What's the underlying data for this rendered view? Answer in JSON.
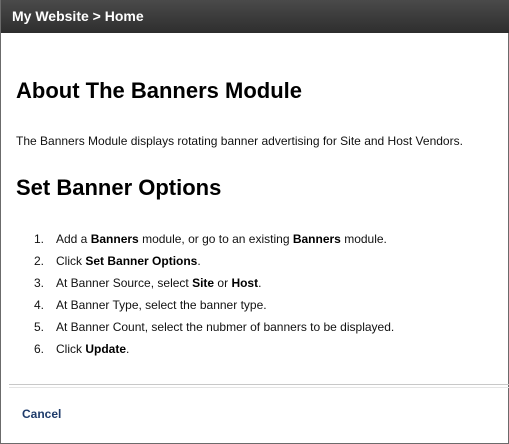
{
  "titlebar": {
    "breadcrumb": "My Website > Home"
  },
  "main": {
    "heading_about": "About The Banners Module",
    "description": "The Banners Module displays rotating banner advertising for Site and Host Vendors.",
    "heading_options": "Set Banner Options",
    "steps": [
      {
        "number": "1.",
        "parts": [
          {
            "t": "Add a ",
            "b": false
          },
          {
            "t": "Banners",
            "b": true
          },
          {
            "t": " module, or go to an existing ",
            "b": false
          },
          {
            "t": "Banners",
            "b": true
          },
          {
            "t": " module.",
            "b": false
          }
        ]
      },
      {
        "number": "2.",
        "parts": [
          {
            "t": "Click ",
            "b": false
          },
          {
            "t": "Set Banner Options",
            "b": true
          },
          {
            "t": ".",
            "b": false
          }
        ]
      },
      {
        "number": "3.",
        "parts": [
          {
            "t": "At Banner Source, select ",
            "b": false
          },
          {
            "t": "Site",
            "b": true
          },
          {
            "t": " or ",
            "b": false
          },
          {
            "t": "Host",
            "b": true
          },
          {
            "t": ".",
            "b": false
          }
        ]
      },
      {
        "number": "4.",
        "parts": [
          {
            "t": "At Banner Type, select the banner type.",
            "b": false
          }
        ]
      },
      {
        "number": "5.",
        "parts": [
          {
            "t": "At Banner Count, select the nubmer of banners to be displayed.",
            "b": false
          }
        ]
      },
      {
        "number": "6.",
        "parts": [
          {
            "t": "Click ",
            "b": false
          },
          {
            "t": "Update",
            "b": true
          },
          {
            "t": ".",
            "b": false
          }
        ]
      }
    ]
  },
  "footer": {
    "cancel_label": "Cancel"
  },
  "colors": {
    "titlebar_bg": "#3a3a3a",
    "link": "#1f3c6b"
  }
}
